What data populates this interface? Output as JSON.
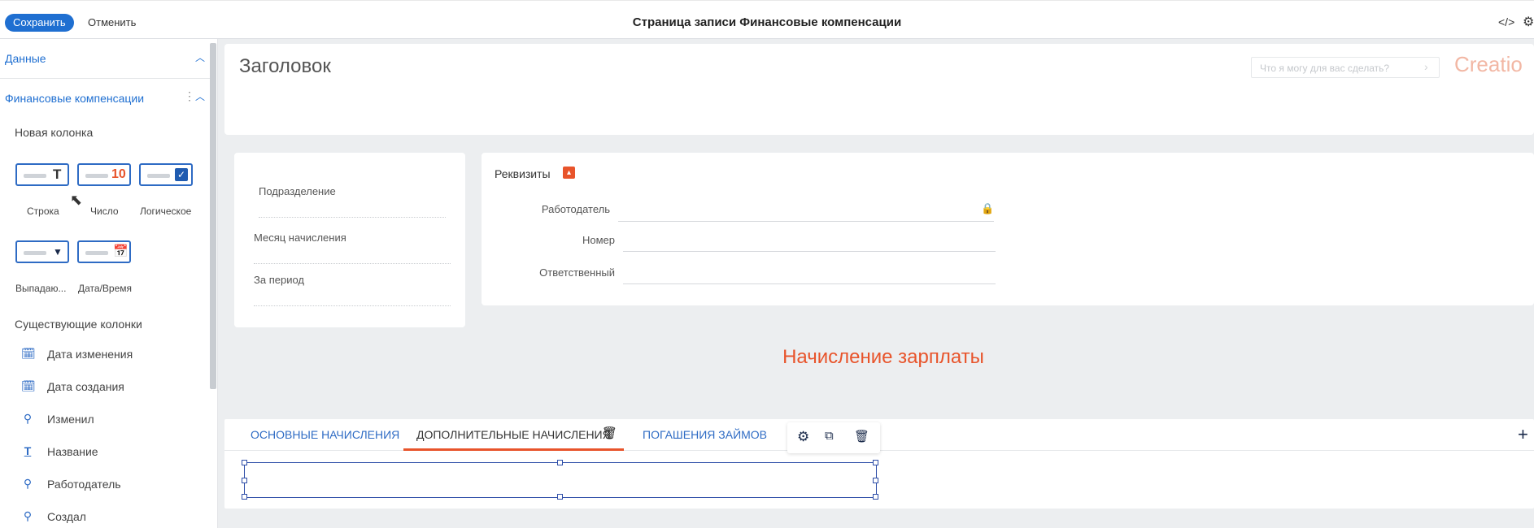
{
  "header": {
    "save_label": "Сохранить",
    "cancel_label": "Отменить",
    "title": "Страница записи Финансовые компенсации"
  },
  "sidebar": {
    "data_section": "Данные",
    "entity_section": "Финансовые компенсации",
    "new_column": "Новая колонка",
    "types": [
      {
        "label": "Строка",
        "glyph": "T"
      },
      {
        "label": "Число",
        "glyph": "10"
      },
      {
        "label": "Логическое",
        "glyph": "✓"
      },
      {
        "label": "Выпадаю...",
        "glyph": "▼"
      },
      {
        "label": "Дата/Время",
        "glyph": "date-time-icon"
      }
    ],
    "existing_columns": "Существующие колонки",
    "columns": [
      {
        "label": "Дата изменения",
        "icon": "calendar-clock-icon"
      },
      {
        "label": "Дата создания",
        "icon": "calendar-clock-icon"
      },
      {
        "label": "Изменил",
        "icon": "search-icon"
      },
      {
        "label": "Название",
        "icon": "text-icon"
      },
      {
        "label": "Работодатель",
        "icon": "search-icon"
      },
      {
        "label": "Создал",
        "icon": "search-icon"
      }
    ]
  },
  "main": {
    "heading": "Заголовок",
    "search_placeholder": "Что я могу для вас сделать?",
    "logo": "Creatio",
    "left_fields": [
      "Подразделение",
      "Месяц начисления",
      "За период"
    ],
    "details": {
      "title": "Реквизиты",
      "fields": [
        "Работодатель",
        "Номер",
        "Ответственный"
      ]
    },
    "section_title": "Начисление зарплаты",
    "tabs": [
      "ОСНОВНЫЕ НАЧИСЛЕНИЯ",
      "ДОПОЛНИТЕЛЬНЫЕ НАЧИСЛЕНИЯ",
      "ПОГАШЕНИЯ ЗАЙМОВ"
    ],
    "active_tab_index": 1
  },
  "colors": {
    "accent": "#1f6fd1",
    "brand_orange": "#e8542b",
    "canvas_bg": "#eceef0"
  }
}
